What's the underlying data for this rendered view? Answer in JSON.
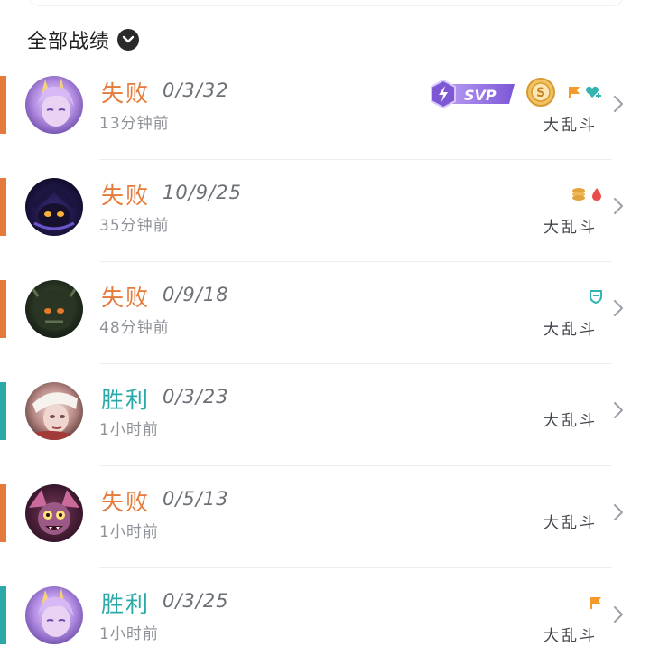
{
  "filter": {
    "label": "全部战绩"
  },
  "colors": {
    "loss": "#e47b3b",
    "win": "#2ba8a8",
    "svp_purple": "#8a63d8",
    "gold": "#e2a43c",
    "flag_orange": "#f39a2b",
    "teal_icon": "#34b3b3",
    "blood_red": "#ea4b4b"
  },
  "matches": [
    {
      "result": "失败",
      "outcome": "loss",
      "kda": "0/3/32",
      "time": "13分钟前",
      "mode": "大乱斗",
      "svp_label": "SVP",
      "badges": [
        "svp-badge",
        "gold-s-medal",
        "orange-flag-icon",
        "teal-heart-plus-icon"
      ]
    },
    {
      "result": "失败",
      "outcome": "loss",
      "kda": "10/9/25",
      "time": "35分钟前",
      "mode": "大乱斗",
      "badges": [
        "gold-coins-icon",
        "blood-drop-icon"
      ]
    },
    {
      "result": "失败",
      "outcome": "loss",
      "kda": "0/9/18",
      "time": "48分钟前",
      "mode": "大乱斗",
      "badges": [
        "teal-shield-icon"
      ]
    },
    {
      "result": "胜利",
      "outcome": "win",
      "kda": "0/3/23",
      "time": "1小时前",
      "mode": "大乱斗",
      "badges": []
    },
    {
      "result": "失败",
      "outcome": "loss",
      "kda": "0/5/13",
      "time": "1小时前",
      "mode": "大乱斗",
      "badges": []
    },
    {
      "result": "胜利",
      "outcome": "win",
      "kda": "0/3/25",
      "time": "1小时前",
      "mode": "大乱斗",
      "badges": [
        "orange-flag-icon"
      ]
    }
  ]
}
